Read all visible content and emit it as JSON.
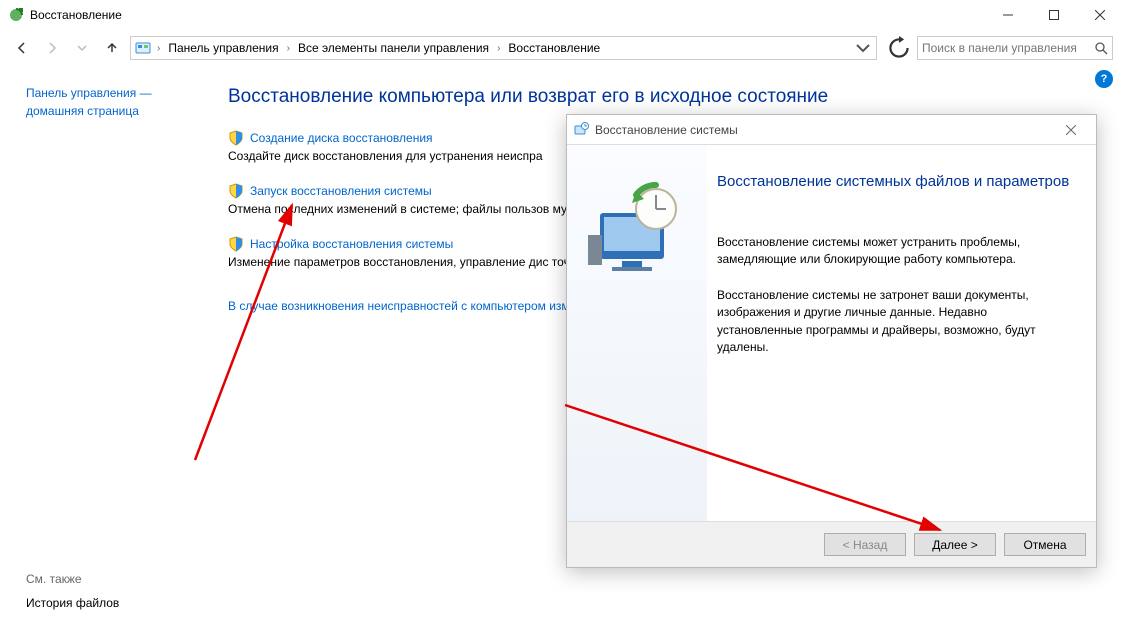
{
  "window": {
    "title": "Восстановление",
    "minimize": "−",
    "maximize": "□",
    "close": "×"
  },
  "breadcrumb": {
    "items": [
      "Панель управления",
      "Все элементы панели управления",
      "Восстановление"
    ]
  },
  "search": {
    "placeholder": "Поиск в панели управления"
  },
  "help": {
    "badge": "?"
  },
  "sidebar": {
    "line1": "Панель управления —",
    "line2": "домашняя страница"
  },
  "page": {
    "title": "Восстановление компьютера или возврат его в исходное состояние",
    "options": [
      {
        "link": "Создание диска восстановления",
        "desc": "Создайте диск восстановления для устранения неиспра"
      },
      {
        "link": "Запуск восстановления системы",
        "desc": "Отмена последних изменений в системе; файлы пользов музыка, остаются без изменений."
      },
      {
        "link": "Настройка восстановления системы",
        "desc": "Изменение параметров восстановления, управление дис точек восстановления."
      }
    ],
    "footer": "В случае возникновения неисправностей с компьютером изменить их."
  },
  "seealso": {
    "header": "См. также",
    "link": "История файлов"
  },
  "dialog": {
    "title": "Восстановление системы",
    "heading": "Восстановление системных файлов и параметров",
    "para1": "Восстановление системы может устранить проблемы, замедляющие или блокирующие работу компьютера.",
    "para2": "Восстановление системы не затронет ваши документы, изображения и другие личные данные. Недавно установленные программы и драйверы, возможно, будут удалены.",
    "back": "< Назад",
    "next": "Далее >",
    "cancel": "Отмена"
  }
}
